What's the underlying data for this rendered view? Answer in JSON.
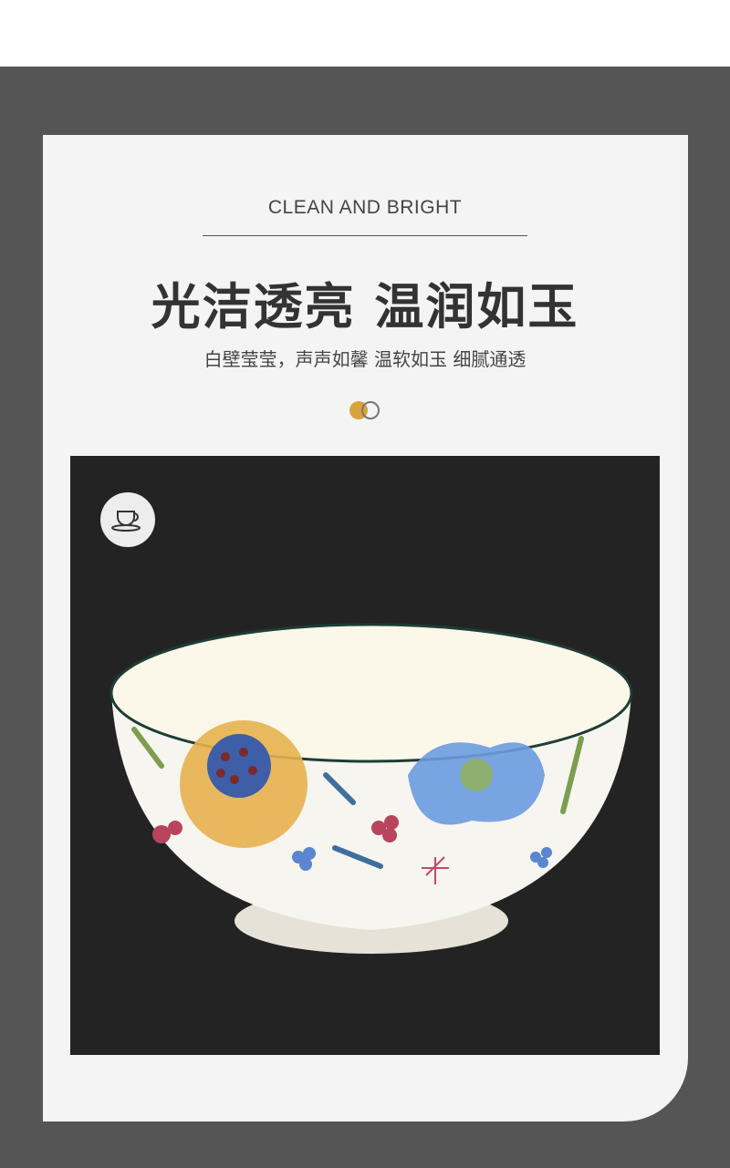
{
  "header": {
    "eyebrow": "CLEAN AND BRIGHT",
    "title": "光洁透亮 温润如玉",
    "subtitle": "白壁莹莹，声声如馨 温软如玉 细腻通透"
  },
  "colors": {
    "background_dark": "#555555",
    "card": "#f4f4f4",
    "photo_background": "#232323",
    "accent_gold": "#d9a33b",
    "rim_green": "#1e3d36"
  },
  "icons": {
    "badge": "coffee-cup-icon",
    "decor": "two-circles-icon"
  },
  "photo": {
    "subject": "floral-bowl-image"
  }
}
